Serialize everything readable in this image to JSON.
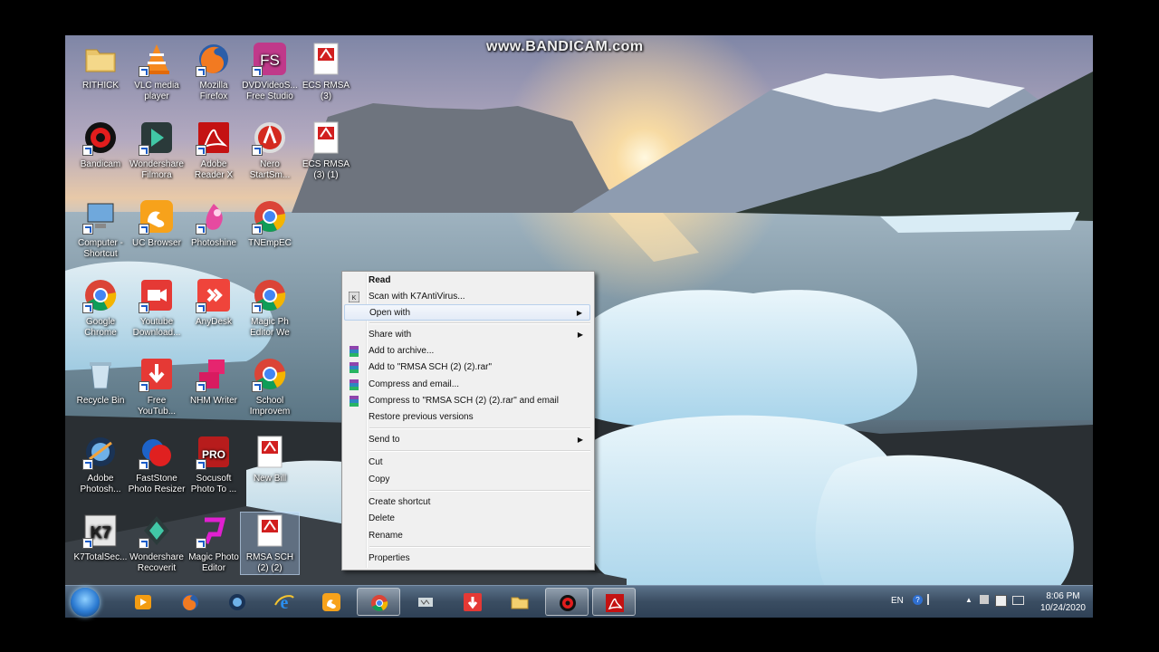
{
  "watermark": "www.BANDICAM.com",
  "desktop_icons": [
    {
      "label": "RITHICK",
      "icon": "folder-icon"
    },
    {
      "label": "VLC media player",
      "icon": "vlc-icon"
    },
    {
      "label": "Mozilla Firefox",
      "icon": "firefox-icon"
    },
    {
      "label": "DVDVideoS... Free Studio",
      "icon": "fs-icon"
    },
    {
      "label": "ECS RMSA (3)",
      "icon": "pdf-icon"
    },
    {
      "label": "Bandicam",
      "icon": "bandicam-icon"
    },
    {
      "label": "Wondershare Filmora",
      "icon": "filmora-icon"
    },
    {
      "label": "Adobe Reader X",
      "icon": "adobe-reader-icon"
    },
    {
      "label": "Nero StartSm...",
      "icon": "nero-icon"
    },
    {
      "label": "ECS RMSA (3) (1)",
      "icon": "pdf-icon"
    },
    {
      "label": "Computer - Shortcut",
      "icon": "computer-icon"
    },
    {
      "label": "UC Browser",
      "icon": "uc-browser-icon"
    },
    {
      "label": "Photoshine",
      "icon": "photoshine-icon"
    },
    {
      "label": "TNEmpEC",
      "icon": "chrome-icon"
    },
    {
      "label": "Google Chrome",
      "icon": "chrome-icon"
    },
    {
      "label": "Youtube Download...",
      "icon": "youtube-downloader-icon"
    },
    {
      "label": "AnyDesk",
      "icon": "anydesk-icon"
    },
    {
      "label": "Magic Ph Editor We",
      "icon": "chrome-icon"
    },
    {
      "label": "Recycle Bin",
      "icon": "recycle-bin-icon"
    },
    {
      "label": "Free YouTub...",
      "icon": "free-youtube-icon"
    },
    {
      "label": "NHM Writer",
      "icon": "nhm-writer-icon"
    },
    {
      "label": "School Improvem",
      "icon": "chrome-icon"
    },
    {
      "label": "Adobe Photosh...",
      "icon": "photoshop-icon"
    },
    {
      "label": "FastStone Photo Resizer",
      "icon": "faststone-icon"
    },
    {
      "label": "Socusoft Photo To ...",
      "icon": "video-pro-icon"
    },
    {
      "label": "New Bill",
      "icon": "pdf-icon"
    },
    {
      "label": "K7TotalSec...",
      "icon": "k7-icon"
    },
    {
      "label": "Wondershare Recoverit",
      "icon": "recoverit-icon"
    },
    {
      "label": "Magic Photo Editor",
      "icon": "magic-photo-icon"
    },
    {
      "label": "RMSA SCH (2) (2)",
      "icon": "pdf-icon"
    }
  ],
  "context_menu": {
    "items": [
      {
        "label": "Read",
        "bold": true
      },
      {
        "label": "Scan with K7AntiVirus...",
        "icon": "k7-scan-icon"
      },
      {
        "label": "Open with",
        "submenu": true,
        "highlighted": true
      },
      {
        "label": "Share with",
        "submenu": true
      },
      {
        "label": "Add to archive...",
        "icon": "winrar-icon"
      },
      {
        "label": "Add to \"RMSA SCH (2) (2).rar\"",
        "icon": "winrar-icon"
      },
      {
        "label": "Compress and email...",
        "icon": "winrar-icon"
      },
      {
        "label": "Compress to \"RMSA SCH (2) (2).rar\" and email",
        "icon": "winrar-icon"
      },
      {
        "label": "Restore previous versions"
      },
      {
        "label": "Send to",
        "submenu": true
      },
      {
        "label": "Cut"
      },
      {
        "label": "Copy"
      },
      {
        "label": "Create shortcut"
      },
      {
        "label": "Delete"
      },
      {
        "label": "Rename"
      },
      {
        "label": "Properties"
      }
    ]
  },
  "taskbar": {
    "apps": [
      "media-player-icon",
      "firefox-icon",
      "adobe-photoshop-icon",
      "internet-explorer-icon",
      "uc-browser-icon",
      "chrome-icon",
      "sound-icon",
      "downloader-icon",
      "file-explorer-icon",
      "bandicam-icon",
      "adobe-reader-icon"
    ],
    "language": "EN",
    "time": "8:06 PM",
    "date": "10/24/2020"
  }
}
